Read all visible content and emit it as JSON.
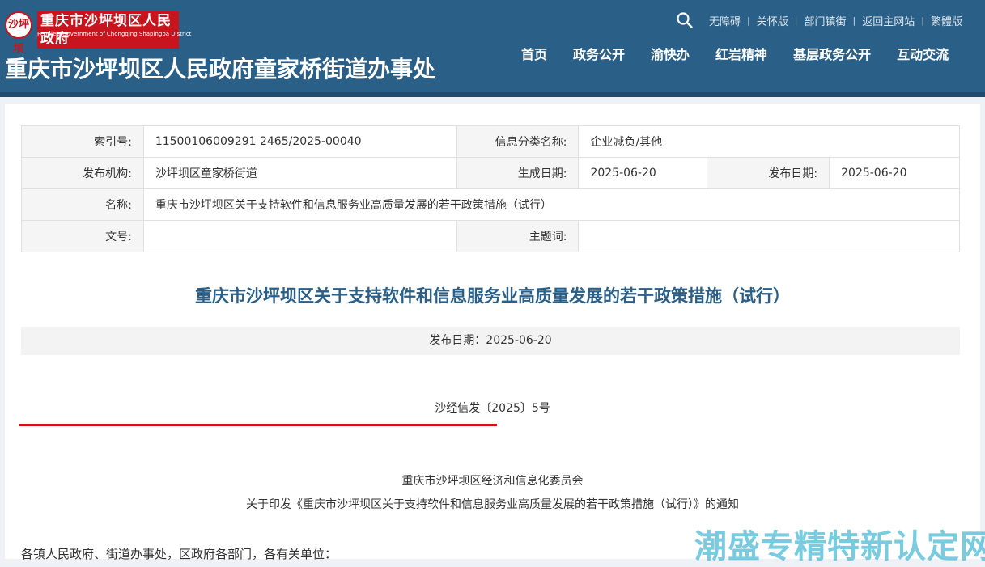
{
  "header": {
    "logo_title": "重庆市沙坪坝区人民政府",
    "logo_subtitle": "People's Government of Chongqing Shapingba District",
    "logo_emblem_text": "沙坪坝",
    "site_title": "重庆市沙坪坝区人民政府童家桥街道办事处",
    "top_links": [
      "无障碍",
      "关怀版",
      "部门镇街",
      "返回主网站",
      "繁體版"
    ],
    "nav": [
      "首页",
      "政务公开",
      "渝快办",
      "红岩精神",
      "基层政务公开",
      "互动交流"
    ],
    "bg_color": "#2a5f88"
  },
  "meta": {
    "index_label": "索引号:",
    "index_value": "11500106009291 2465/2025-00040",
    "category_label": "信息分类名称:",
    "category_value": "企业减负/其他",
    "publisher_label": "发布机构:",
    "publisher_value": "沙坪坝区童家桥街道",
    "created_label": "生成日期:",
    "created_value": "2025-06-20",
    "published_label": "发布日期:",
    "published_value": "2025-06-20",
    "name_label": "名称:",
    "name_value": "重庆市沙坪坝区关于支持软件和信息服务业高质量发展的若干政策措施（试行）",
    "docno_label": "文号:",
    "docno_value": "",
    "keywords_label": "主题词:",
    "keywords_value": ""
  },
  "document": {
    "title": "重庆市沙坪坝区关于支持软件和信息服务业高质量发展的若干政策措施（试行）",
    "publish_date_text": "发布日期：2025-06-20",
    "doc_number": "沙经信发〔2025〕5号",
    "issuer": "重庆市沙坪坝区经济和信息化委员会",
    "notice_title": "关于印发《重庆市沙坪坝区关于支持软件和信息服务业高质量发展的若干政策措施（试行）》的通知",
    "salutation": "各镇人民政府、街道办事处，区政府各部门，各有关单位：",
    "accent_color": "#d7111b"
  },
  "watermark": "潮盛专精特新认定网"
}
